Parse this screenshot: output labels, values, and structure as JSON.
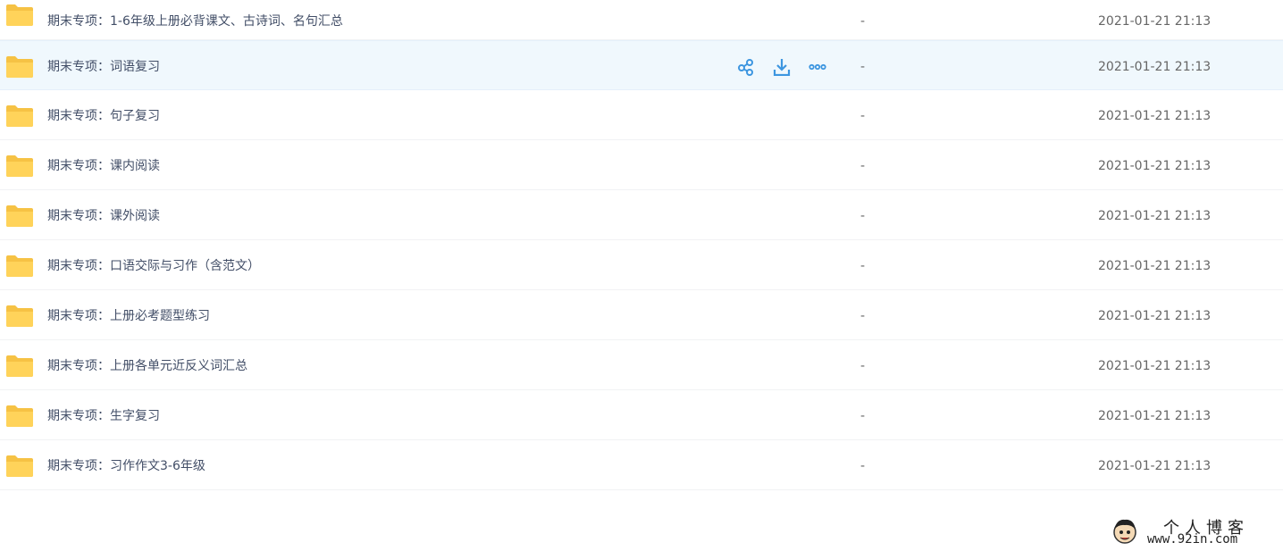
{
  "rows": [
    {
      "name": "期末专项：1-6年级上册必背课文、古诗词、名句汇总",
      "size": "-",
      "date": "2021-01-21 21:13"
    },
    {
      "name": "期末专项：词语复习",
      "size": "-",
      "date": "2021-01-21 21:13"
    },
    {
      "name": "期末专项：句子复习",
      "size": "-",
      "date": "2021-01-21 21:13"
    },
    {
      "name": "期末专项：课内阅读",
      "size": "-",
      "date": "2021-01-21 21:13"
    },
    {
      "name": "期末专项：课外阅读",
      "size": "-",
      "date": "2021-01-21 21:13"
    },
    {
      "name": "期末专项：口语交际与习作（含范文）",
      "size": "-",
      "date": "2021-01-21 21:13"
    },
    {
      "name": "期末专项：上册必考题型练习",
      "size": "-",
      "date": "2021-01-21 21:13"
    },
    {
      "name": "期末专项：上册各单元近反义词汇总",
      "size": "-",
      "date": "2021-01-21 21:13"
    },
    {
      "name": "期末专项：生字复习",
      "size": "-",
      "date": "2021-01-21 21:13"
    },
    {
      "name": "期末专项：习作作文3-6年级",
      "size": "-",
      "date": "2021-01-21 21:13"
    }
  ],
  "row_actions": {
    "share_icon": "share-icon",
    "download_icon": "download-icon",
    "more_icon": "more-icon"
  },
  "watermark": {
    "title": "个人博客",
    "url": "www.92in.com"
  },
  "colors": {
    "folder": "#ffd35a",
    "folder_tab": "#f6c244",
    "action": "#3d96e0",
    "hover_row": "#f0f8fd"
  }
}
